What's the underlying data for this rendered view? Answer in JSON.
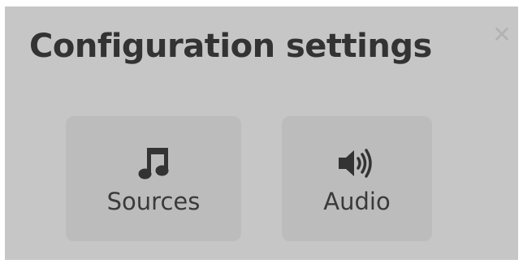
{
  "dialog": {
    "title": "Configuration settings",
    "close_icon": "close-icon",
    "close_glyph": "✕",
    "background_color": "#c6c6c6"
  },
  "tiles": [
    {
      "label": "Sources",
      "icon": "music-note-icon"
    },
    {
      "label": "Audio",
      "icon": "speaker-volume-icon"
    }
  ]
}
